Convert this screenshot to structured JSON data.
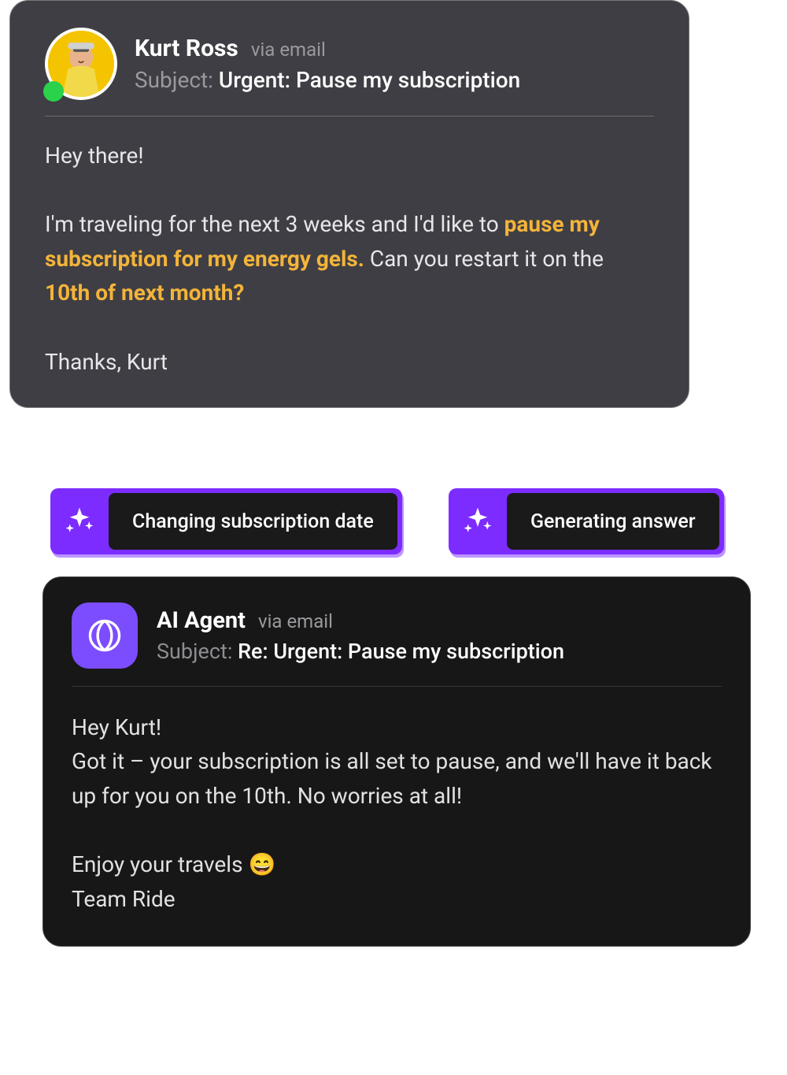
{
  "customer": {
    "name": "Kurt Ross",
    "via": "via email",
    "subject_label": "Subject:",
    "subject": "Urgent: Pause my subscription",
    "status": "online",
    "body": {
      "greeting": "Hey there!",
      "line1_a": "I'm traveling for the next 3 weeks and I'd like to ",
      "hl1": "pause my subscription for my energy gels.",
      "line1_b": " Can you restart it on the ",
      "hl2": "10th of next month?",
      "signoff": "Thanks, Kurt"
    }
  },
  "actions": {
    "change_date": "Changing subscription date",
    "generate": "Generating answer"
  },
  "agent": {
    "name": "AI Agent",
    "via": "via email",
    "subject_label": "Subject:",
    "subject": "Re: Urgent: Pause my subscription",
    "body": {
      "greeting": "Hey Kurt!",
      "main": "Got it – your subscription is all set to pause, and we'll have it back up for you on the 10th. No worries at all!",
      "enjoy": "Enjoy your travels 😄",
      "sign": "Team Ride"
    }
  },
  "colors": {
    "highlight": "#f3b43a",
    "purple": "#7c2cff",
    "online": "#29d24a"
  }
}
